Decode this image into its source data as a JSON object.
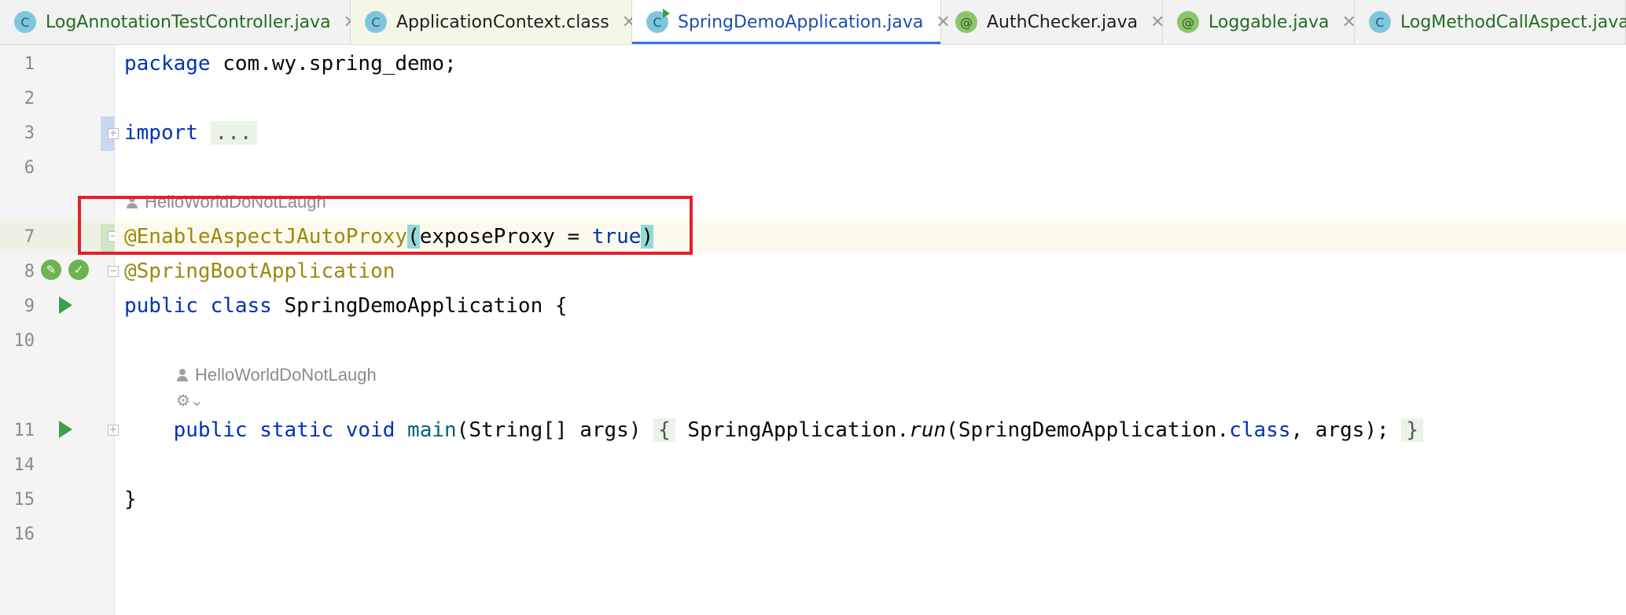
{
  "tabs": [
    {
      "label": "LogAnnotationTestController.java",
      "icon": "C",
      "icon_name": "class-icon"
    },
    {
      "label": "ApplicationContext.class",
      "icon": "C",
      "icon_name": "class-icon"
    },
    {
      "label": "SpringDemoApplication.java",
      "icon": "C",
      "icon_name": "runnable-class-icon",
      "active": true
    },
    {
      "label": "AuthChecker.java",
      "icon": "@",
      "icon_name": "annotation-icon"
    },
    {
      "label": "Loggable.java",
      "icon": "@",
      "icon_name": "annotation-icon"
    },
    {
      "label": "LogMethodCallAspect.java",
      "icon": "C",
      "icon_name": "class-icon"
    }
  ],
  "close_glyph": "✕",
  "gutter": {
    "line_numbers": [
      "1",
      "2",
      "3",
      "6",
      "7",
      "8",
      "9",
      "10",
      "11",
      "14",
      "15",
      "16"
    ]
  },
  "code": {
    "line1": {
      "kw": "package",
      "rest": " com.wy.spring_demo;"
    },
    "line3": {
      "kw": "import",
      "folded": "..."
    },
    "author_hint": "HelloWorldDoNotLaugh",
    "line7": {
      "annotation": "@EnableAspectJAutoProxy",
      "open": "(",
      "param": "exposeProxy = ",
      "value": "true",
      "close": ")"
    },
    "line8": {
      "annotation": "@SpringBootApplication"
    },
    "line9": {
      "kw": "public class",
      "name": " SpringDemoApplication {"
    },
    "line11": {
      "kw": "public static void",
      "method": "main",
      "params": "(String[] args) ",
      "open": "{",
      "call_class": " SpringApplication.",
      "call_method": "run",
      "args_pre": "(SpringDemoApplication.",
      "args_kw": "class",
      "args_post": ", args); ",
      "close": "}"
    },
    "line15": "}"
  },
  "colors": {
    "keyword": "#0033b3",
    "annotation": "#9e880d",
    "highlight_box": "#e3202a",
    "active_tab_underline": "#3574f0"
  }
}
